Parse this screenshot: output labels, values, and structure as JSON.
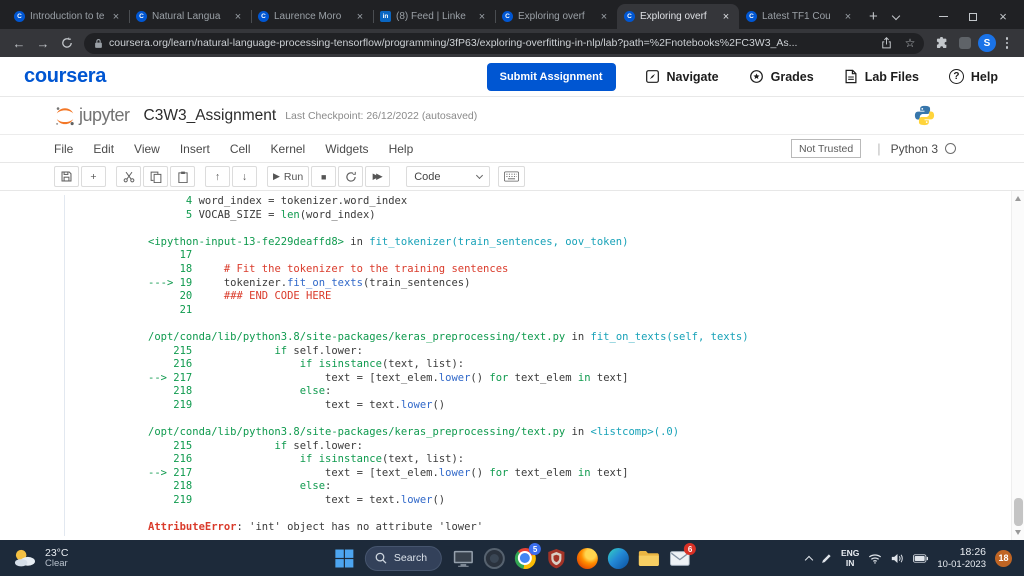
{
  "browser": {
    "tabs": [
      {
        "title": "Introduction to te",
        "icon": "coursera",
        "active": false
      },
      {
        "title": "Natural Langua",
        "icon": "coursera",
        "active": false
      },
      {
        "title": "Laurence Moro",
        "icon": "coursera",
        "active": false
      },
      {
        "title": "(8) Feed | Linke",
        "icon": "linkedin",
        "active": false
      },
      {
        "title": "Exploring overf",
        "icon": "coursera",
        "active": false
      },
      {
        "title": "Exploring overf",
        "icon": "coursera",
        "active": true
      },
      {
        "title": "Latest TF1 Cou",
        "icon": "coursera",
        "active": false
      }
    ],
    "url": "coursera.org/learn/natural-language-processing-tensorflow/programming/3fP63/exploring-overfitting-in-nlp/lab?path=%2Fnotebooks%2FC3W3_As...",
    "avatar_letter": "S"
  },
  "coursera": {
    "logo": "coursera",
    "submit_label": "Submit Assignment",
    "nav": [
      {
        "label": "Navigate",
        "icon": "navigate-icon"
      },
      {
        "label": "Grades",
        "icon": "grades-icon"
      },
      {
        "label": "Lab Files",
        "icon": "lab-files-icon"
      },
      {
        "label": "Help",
        "icon": "help-icon"
      }
    ]
  },
  "jupyter": {
    "brand": "jupyter",
    "title": "C3W3_Assignment",
    "checkpoint": "Last Checkpoint: 26/12/2022",
    "autosaved": "(autosaved)",
    "menus": [
      "File",
      "Edit",
      "View",
      "Insert",
      "Cell",
      "Kernel",
      "Widgets",
      "Help"
    ],
    "trust_badge": "Not Trusted",
    "kernel_name": "Python 3",
    "toolbar": {
      "run_label": "Run",
      "cell_type": "Code"
    }
  },
  "traceback": {
    "lines": [
      [
        [
          "      4 ",
          "g"
        ],
        [
          "word_index = tokenizer.word_index",
          ""
        ]
      ],
      [
        [
          "      5 ",
          "g"
        ],
        [
          "VOCAB_SIZE = ",
          ""
        ],
        [
          "len",
          "g"
        ],
        [
          "(word_index)",
          ""
        ]
      ],
      [],
      [
        [
          "<ipython-input-13-fe229deaffd8>",
          "g"
        ],
        [
          " in ",
          ""
        ],
        [
          "fit_tokenizer(train_sentences, oov_token)",
          "c"
        ]
      ],
      [
        [
          "     17 ",
          "g"
        ]
      ],
      [
        [
          "     18 ",
          "g"
        ],
        [
          "    ",
          ""
        ],
        [
          "# Fit the tokenizer to the training sentences",
          "r"
        ]
      ],
      [
        [
          "---> 19 ",
          "g"
        ],
        [
          "    tokenizer.",
          ""
        ],
        [
          "fit_on_texts",
          "b"
        ],
        [
          "(train_sentences)",
          ""
        ]
      ],
      [
        [
          "     20 ",
          "g"
        ],
        [
          "    ",
          ""
        ],
        [
          "### END CODE HERE",
          "r"
        ]
      ],
      [
        [
          "     21 ",
          "g"
        ]
      ],
      [],
      [
        [
          "/opt/conda/lib/python3.8/site-packages/keras_preprocessing/text.py",
          "g"
        ],
        [
          " in ",
          ""
        ],
        [
          "fit_on_texts(self, texts)",
          "c"
        ]
      ],
      [
        [
          "    215 ",
          "g"
        ],
        [
          "            ",
          ""
        ],
        [
          "if",
          "g"
        ],
        [
          " self.lower:",
          ""
        ]
      ],
      [
        [
          "    216 ",
          "g"
        ],
        [
          "                ",
          ""
        ],
        [
          "if",
          "g"
        ],
        [
          " ",
          ""
        ],
        [
          "isinstance",
          "g"
        ],
        [
          "(text, list):",
          ""
        ]
      ],
      [
        [
          "--> 217 ",
          "g"
        ],
        [
          "                    text = [text_elem.",
          ""
        ],
        [
          "lower",
          "b"
        ],
        [
          "() ",
          ""
        ],
        [
          "for",
          "g"
        ],
        [
          " text_elem ",
          ""
        ],
        [
          "in",
          "g"
        ],
        [
          " text]",
          ""
        ]
      ],
      [
        [
          "    218 ",
          "g"
        ],
        [
          "                ",
          ""
        ],
        [
          "else",
          "g"
        ],
        [
          ":",
          ""
        ]
      ],
      [
        [
          "    219 ",
          "g"
        ],
        [
          "                    text = text.",
          ""
        ],
        [
          "lower",
          "b"
        ],
        [
          "()",
          ""
        ]
      ],
      [],
      [
        [
          "/opt/conda/lib/python3.8/site-packages/keras_preprocessing/text.py",
          "g"
        ],
        [
          " in ",
          ""
        ],
        [
          "<listcomp>(.0)",
          "c"
        ]
      ],
      [
        [
          "    215 ",
          "g"
        ],
        [
          "            ",
          ""
        ],
        [
          "if",
          "g"
        ],
        [
          " self.lower:",
          ""
        ]
      ],
      [
        [
          "    216 ",
          "g"
        ],
        [
          "                ",
          ""
        ],
        [
          "if",
          "g"
        ],
        [
          " ",
          ""
        ],
        [
          "isinstance",
          "g"
        ],
        [
          "(text, list):",
          ""
        ]
      ],
      [
        [
          "--> 217 ",
          "g"
        ],
        [
          "                    text = [text_elem.",
          ""
        ],
        [
          "lower",
          "b"
        ],
        [
          "() ",
          ""
        ],
        [
          "for",
          "g"
        ],
        [
          " text_elem ",
          ""
        ],
        [
          "in",
          "g"
        ],
        [
          " text]",
          ""
        ]
      ],
      [
        [
          "    218 ",
          "g"
        ],
        [
          "                ",
          ""
        ],
        [
          "else",
          "g"
        ],
        [
          ":",
          ""
        ]
      ],
      [
        [
          "    219 ",
          "g"
        ],
        [
          "                    text = text.",
          ""
        ],
        [
          "lower",
          "b"
        ],
        [
          "()",
          ""
        ]
      ],
      [],
      [
        [
          "AttributeError",
          "e"
        ],
        [
          ": 'int' object has no attribute 'lower'",
          ""
        ]
      ]
    ]
  },
  "taskbar": {
    "weather_temp": "23°C",
    "weather_cond": "Clear",
    "search_label": "Search",
    "chrome_badge": "5",
    "mail_badge": "6",
    "lang_line1": "ENG",
    "lang_line2": "IN",
    "time": "18:26",
    "date": "10-01-2023",
    "notif_badge": "18"
  }
}
